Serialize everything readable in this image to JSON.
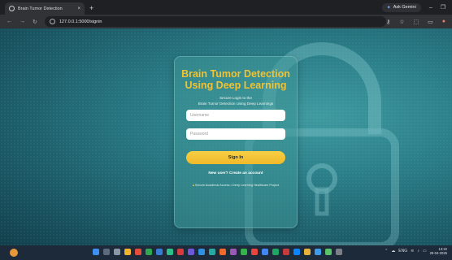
{
  "browser": {
    "tab_title": "Brain Tumor Detection",
    "tab_close": "×",
    "new_tab": "+",
    "gemini_label": "Ask Gemini",
    "minimize": "–",
    "url": "127.0.0.1:5000/signin"
  },
  "login": {
    "title": "Brain Tumor Detection Using Deep Learning",
    "subtitle_line1": "Secure Login to the",
    "subtitle_line2": "Brain Tumor Detection Using Deep Learnings",
    "username_placeholder": "Username",
    "password_placeholder": "Password",
    "signin_label": "Sign In",
    "new_user_text": "New user?",
    "create_account": "Create an account",
    "footnote": "Secure Academic Access • Deep Learning Healthcare Project"
  },
  "taskbar": {
    "time": "13:22",
    "date": "29-04-2025",
    "lang": "ENG"
  },
  "colors": {
    "accent_yellow": "#f2c232",
    "teal_background": "#2a7d87"
  }
}
